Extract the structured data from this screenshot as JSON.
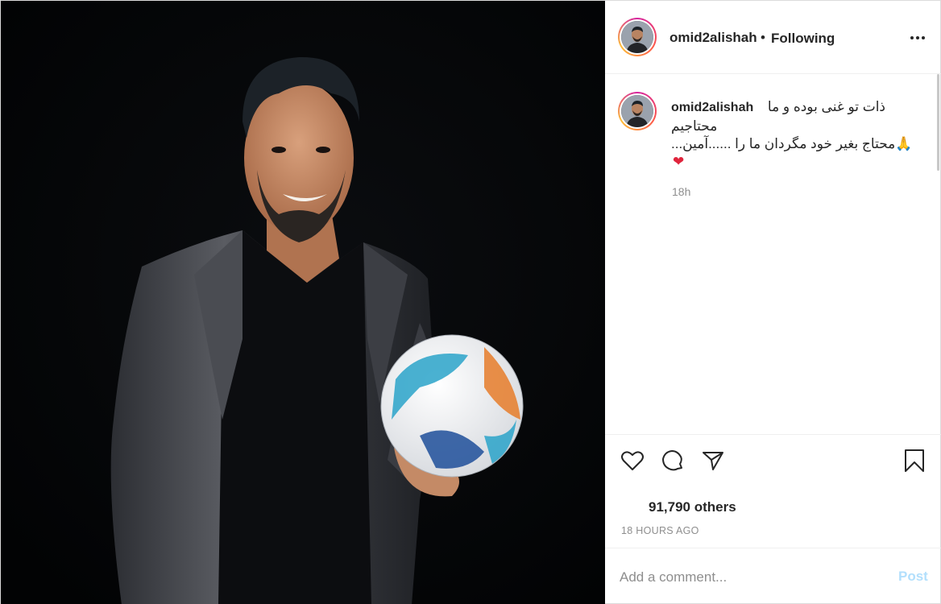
{
  "post": {
    "username": "omid2alishah",
    "header_separator": "•",
    "follow_status": "Following",
    "menu_icon": "more-horizontal-icon"
  },
  "caption": {
    "username": "omid2alishah",
    "line1": "ذات تو غنی بوده و ما",
    "line2": "محتاجیم",
    "line3": "...محتاج بغیر خود مگردان ما را ......آمین",
    "line3_emoji": "🙏",
    "line4_emoji": "❤",
    "time": "18h"
  },
  "actions": {
    "icons": [
      "heart-icon",
      "comment-icon",
      "share-icon",
      "bookmark-icon"
    ]
  },
  "likes": {
    "text": "91,790 others"
  },
  "timestamp": "18 HOURS AGO",
  "comment": {
    "placeholder": "Add a comment...",
    "post_label": "Post"
  },
  "colors": {
    "text": "#262626",
    "muted": "#8e8e8e",
    "post_disabled": "#b2dffc",
    "border": "#dbdbdb",
    "heart_red": "#e0243c"
  }
}
